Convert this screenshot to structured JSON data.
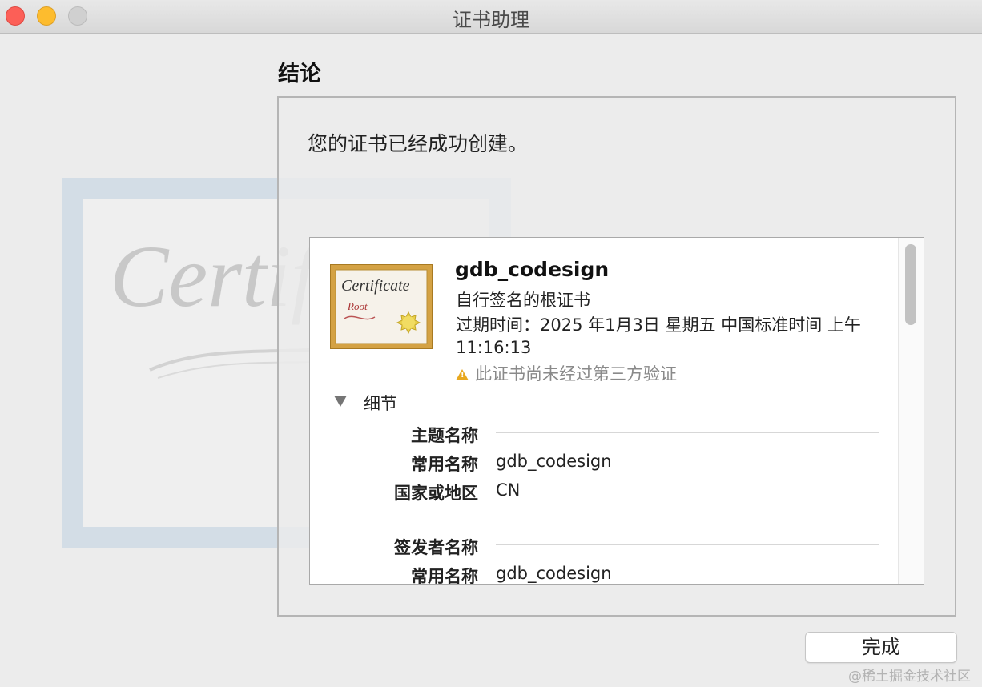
{
  "window": {
    "title": "证书助理"
  },
  "section_title": "结论",
  "message": "您的证书已经成功创建。",
  "background_art": {
    "script_text": "Certif"
  },
  "certificate": {
    "icon_title": "Certificate",
    "icon_subtitle": "Root",
    "name": "gdb_codesign",
    "type": "自行签名的根证书",
    "expiry": "过期时间：2025 年1月3日 星期五 中国标准时间 上午11:16:13",
    "warning": "此证书尚未经过第三方验证"
  },
  "details": {
    "label": "细节",
    "subject": {
      "header": "主题名称",
      "rows": [
        {
          "label": "常用名称",
          "value": "gdb_codesign"
        },
        {
          "label": "国家或地区",
          "value": "CN"
        }
      ]
    },
    "issuer": {
      "header": "签发者名称",
      "rows": [
        {
          "label": "常用名称",
          "value": "gdb_codesign"
        }
      ]
    }
  },
  "buttons": {
    "done": "完成"
  },
  "watermark": "@稀土掘金技术社区",
  "colors": {
    "close": "#fc5f57",
    "minimize": "#fdbc2e",
    "zoom_disabled": "#d0d0d0",
    "warning": "#e8a81f",
    "certificate_gold": "#d4a244"
  }
}
